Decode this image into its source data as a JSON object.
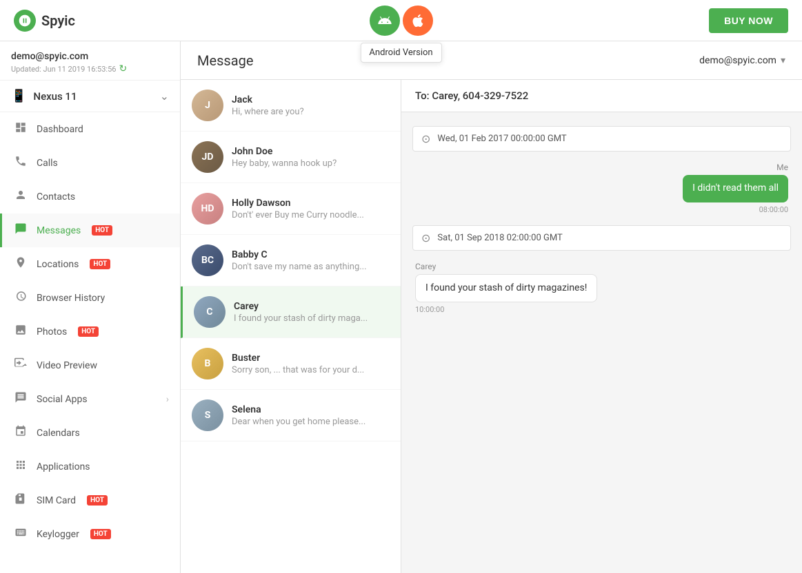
{
  "header": {
    "logo_text": "Spyic",
    "platform_tooltip": "Android Version",
    "buy_now_label": "BUY NOW"
  },
  "sidebar": {
    "user_email": "demo@spyic.com",
    "updated_label": "Updated: Jun 11 2019 16:53:56",
    "device_name": "Nexus 11",
    "nav_items": [
      {
        "id": "dashboard",
        "label": "Dashboard",
        "icon": "○",
        "hot": false
      },
      {
        "id": "calls",
        "label": "Calls",
        "icon": "☎",
        "hot": false
      },
      {
        "id": "contacts",
        "label": "Contacts",
        "icon": "👤",
        "hot": false
      },
      {
        "id": "messages",
        "label": "Messages",
        "icon": "💬",
        "hot": true,
        "active": true
      },
      {
        "id": "locations",
        "label": "Locations",
        "icon": "📍",
        "hot": true
      },
      {
        "id": "browser-history",
        "label": "Browser History",
        "icon": "🕐",
        "hot": false
      },
      {
        "id": "photos",
        "label": "Photos",
        "icon": "🖼",
        "hot": true
      },
      {
        "id": "video-preview",
        "label": "Video Preview",
        "icon": "📹",
        "hot": false
      },
      {
        "id": "social-apps",
        "label": "Social Apps",
        "icon": "💬",
        "hot": false,
        "arrow": true
      },
      {
        "id": "calendars",
        "label": "Calendars",
        "icon": "📅",
        "hot": false
      },
      {
        "id": "applications",
        "label": "Applications",
        "icon": "⚏",
        "hot": false
      },
      {
        "id": "sim-card",
        "label": "SIM Card",
        "icon": "💳",
        "hot": true
      },
      {
        "id": "keylogger",
        "label": "Keylogger",
        "icon": "⌨",
        "hot": true
      }
    ]
  },
  "page": {
    "title": "Message",
    "account_email": "demo@spyic.com"
  },
  "contacts": [
    {
      "id": "jack",
      "name": "Jack",
      "preview": "Hi, where are you?",
      "avatar_label": "J",
      "avatar_class": "jack-avatar"
    },
    {
      "id": "john-doe",
      "name": "John Doe",
      "preview": "Hey baby, wanna hook up?",
      "avatar_label": "JD",
      "avatar_class": "john-avatar"
    },
    {
      "id": "holly-dawson",
      "name": "Holly Dawson",
      "preview": "Don't' ever Buy me Curry noodle...",
      "avatar_label": "HD",
      "avatar_class": "holly-avatar"
    },
    {
      "id": "babby-c",
      "name": "Babby C",
      "preview": "Don't save my name as anything...",
      "avatar_label": "BC",
      "avatar_class": "babby-avatar"
    },
    {
      "id": "carey",
      "name": "Carey",
      "preview": "I found your stash of dirty maga...",
      "avatar_label": "C",
      "avatar_class": "carey-avatar",
      "active": true
    },
    {
      "id": "buster",
      "name": "Buster",
      "preview": "Sorry son, ... that was for your d...",
      "avatar_label": "B",
      "avatar_class": "buster-avatar"
    },
    {
      "id": "selena",
      "name": "Selena",
      "preview": "Dear when you get home please...",
      "avatar_label": "S",
      "avatar_class": "selena-avatar"
    }
  ],
  "chat": {
    "to": "To: Carey, 604-329-7522",
    "date1": "Wed, 01 Feb 2017 00:00:00 GMT",
    "message1_sender": "Me",
    "message1_text": "I didn't read them all",
    "message1_time": "08:00:00",
    "date2": "Sat, 01 Sep 2018 02:00:00 GMT",
    "message2_sender": "Carey",
    "message2_text": "I found your stash of dirty magazines!",
    "message2_time": "10:00:00"
  }
}
